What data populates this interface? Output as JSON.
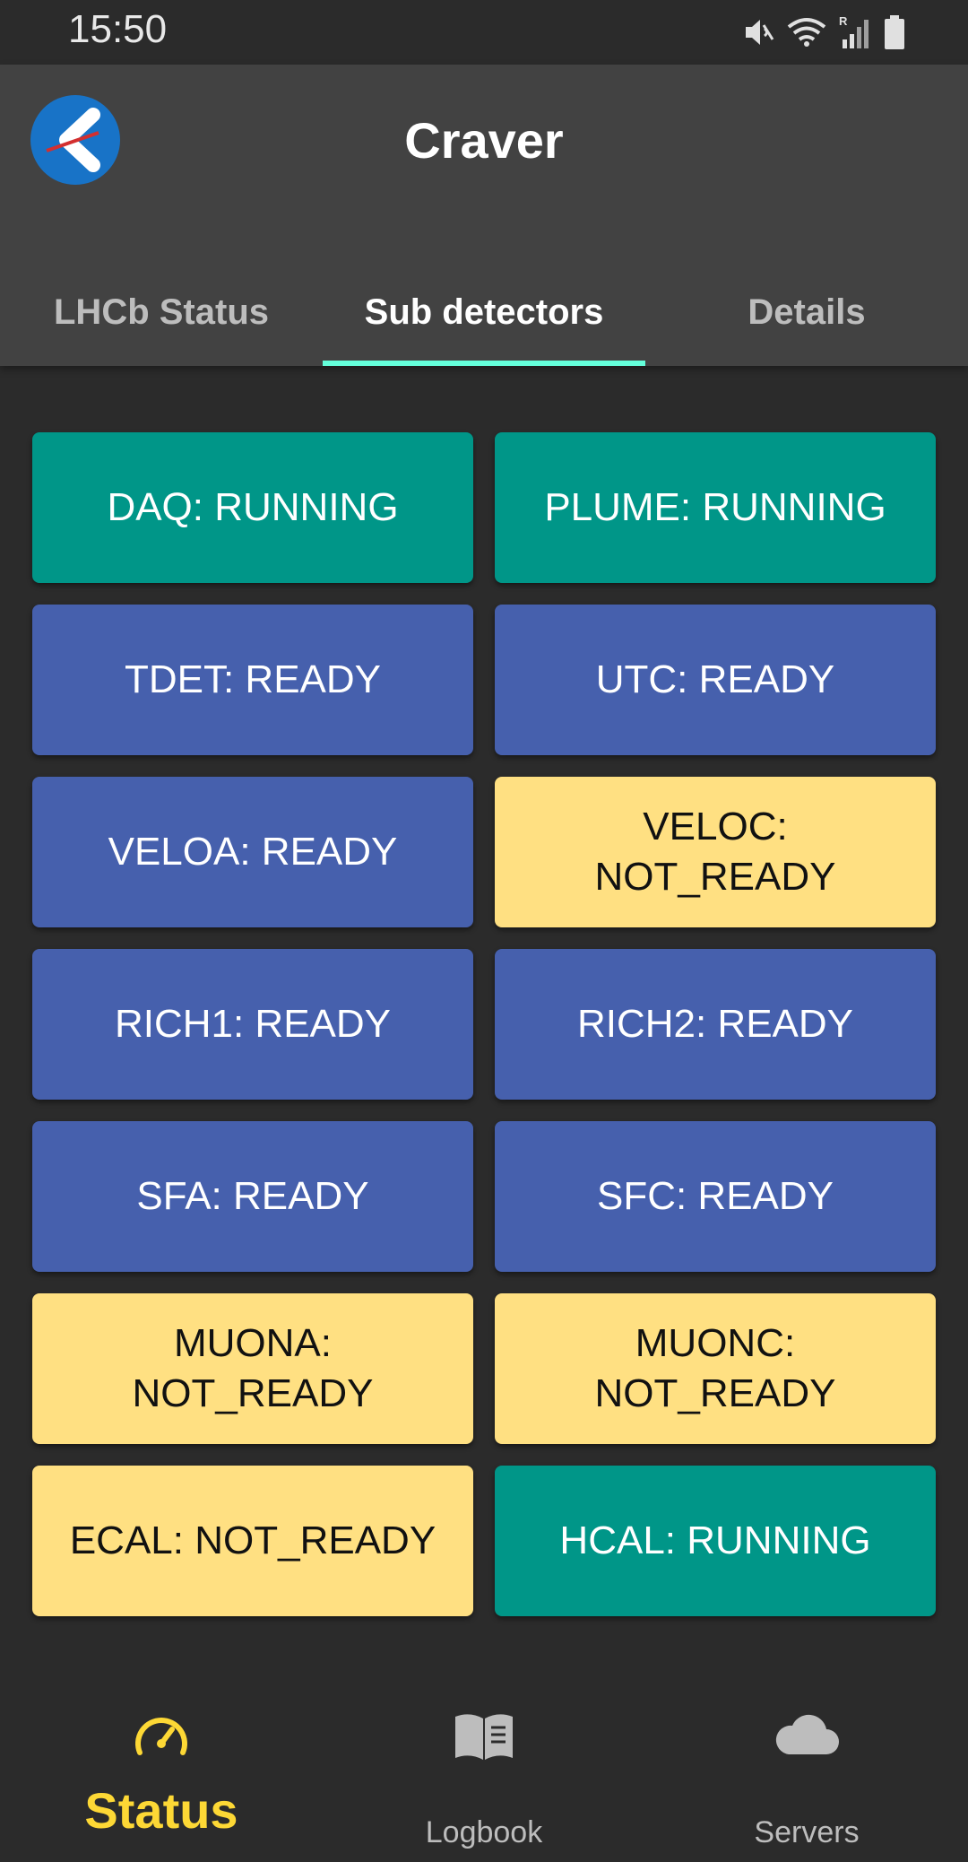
{
  "status_bar": {
    "time": "15:50",
    "icons": [
      "mute-icon",
      "wifi-icon",
      "signal-icon",
      "battery-icon"
    ]
  },
  "app_bar": {
    "title": "Craver",
    "logo": "craver-logo-icon"
  },
  "tabs": [
    {
      "label": "LHCb Status",
      "active": false
    },
    {
      "label": "Sub detectors",
      "active": true
    },
    {
      "label": "Details",
      "active": false
    }
  ],
  "detectors": [
    {
      "label": "DAQ: RUNNING",
      "state": "running"
    },
    {
      "label": "PLUME: RUNNING",
      "state": "running"
    },
    {
      "label": "TDET: READY",
      "state": "ready"
    },
    {
      "label": "UTC: READY",
      "state": "ready"
    },
    {
      "label": "VELOA: READY",
      "state": "ready"
    },
    {
      "label": "VELOC: NOT_READY",
      "state": "not-ready"
    },
    {
      "label": "RICH1: READY",
      "state": "ready"
    },
    {
      "label": "RICH2: READY",
      "state": "ready"
    },
    {
      "label": "SFA: READY",
      "state": "ready"
    },
    {
      "label": "SFC: READY",
      "state": "ready"
    },
    {
      "label": "MUONA: NOT_READY",
      "state": "not-ready"
    },
    {
      "label": "MUONC: NOT_READY",
      "state": "not-ready"
    },
    {
      "label": "ECAL: NOT_READY",
      "state": "not-ready"
    },
    {
      "label": "HCAL: RUNNING",
      "state": "running"
    }
  ],
  "colors": {
    "running": "#009688",
    "ready": "#4660ad",
    "not_ready": "#ffe082",
    "accent": "#64ffda",
    "nav_active": "#fdd835"
  },
  "bottom_nav": [
    {
      "label": "Status",
      "icon": "speedometer-icon",
      "active": true
    },
    {
      "label": "Logbook",
      "icon": "book-icon",
      "active": false
    },
    {
      "label": "Servers",
      "icon": "cloud-icon",
      "active": false
    }
  ]
}
